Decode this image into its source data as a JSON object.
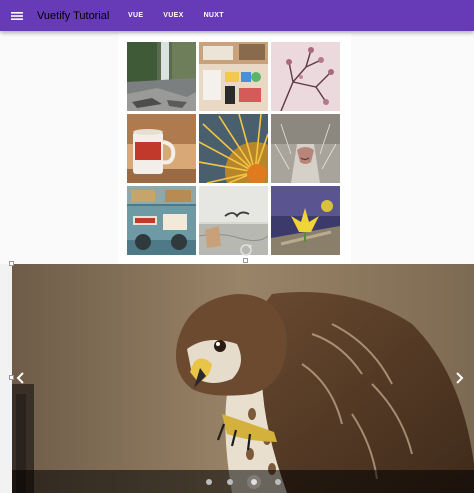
{
  "app": {
    "title": "Vuetify Tutorial",
    "menu_icon": "hamburger-menu-icon"
  },
  "nav": {
    "links": [
      "VUE",
      "VUEX",
      "NUXT"
    ]
  },
  "colors": {
    "toolbar": "#673ab7",
    "nav_text": "#ffffff",
    "title_text": "#000000"
  },
  "gallery": {
    "tiles": [
      "waterfall-photo",
      "desk-items-photo",
      "pink-branches-photo",
      "coffee-mug-photo",
      "sunburst-flower-photo",
      "cat-nose-photo",
      "vintage-car-photo",
      "bird-over-water-photo",
      "yellow-flower-photo"
    ]
  },
  "carousel": {
    "image": "hawk-photo",
    "prev_icon": "chevron-left-icon",
    "next_icon": "chevron-right-icon",
    "slide_count": 4,
    "active_index": 2
  }
}
